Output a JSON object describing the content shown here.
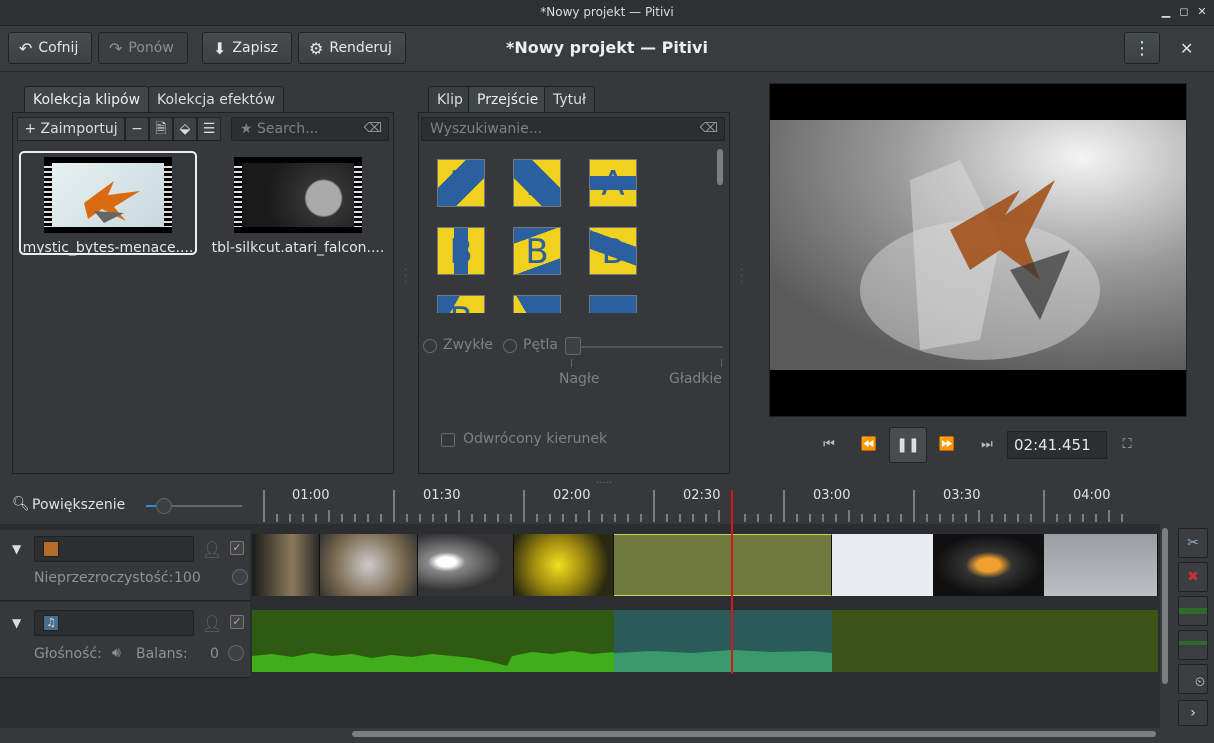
{
  "window": {
    "title": "*Nowy projekt — Pitivi",
    "minimize_icon": "minimize-icon",
    "maximize_icon": "maximize-icon",
    "close_icon": "close-icon"
  },
  "header": {
    "undo_label": "Cofnij",
    "redo_label": "Ponów",
    "save_label": "Zapisz",
    "render_label": "Renderuj",
    "title": "*Nowy projekt — Pitivi"
  },
  "library": {
    "tabs": [
      "Kolekcja klipów",
      "Kolekcja efektów"
    ],
    "import_label": "Zaimportuj",
    "search_placeholder": "Search...",
    "clips": [
      {
        "name": "mystic_bytes-menace...."
      },
      {
        "name": "tbl-silkcut.atari_falcon...."
      }
    ]
  },
  "transitions": {
    "tabs": [
      "Klip",
      "Przejście",
      "Tytuł"
    ],
    "search_placeholder": "Wyszukiwanie...",
    "thumbs": [
      "B",
      "B",
      "A",
      "B",
      "B",
      "B",
      "B",
      "B",
      "B"
    ],
    "mode_normal": "Zwykłe",
    "mode_loop": "Pętla",
    "border_left": "Nagłe",
    "border_right": "Gładkie",
    "invert_label": "Odwrócony kierunek"
  },
  "viewer": {
    "timecode": "02:41.451"
  },
  "timeline": {
    "zoom_label": "Powiększenie",
    "ruler": [
      "01:00",
      "01:30",
      "02:00",
      "02:30",
      "03:00",
      "03:30",
      "04:00"
    ],
    "video_layer": {
      "opacity_label": "Nieprzezroczystość:",
      "opacity_value": "100"
    },
    "audio_layer": {
      "volume_label": "Głośność:",
      "balance_label": "Balans:",
      "balance_value": "0"
    }
  },
  "colors": {
    "accent": "#2b5f9e",
    "playhead": "#d81818",
    "audio_wave": "#3fae1a",
    "selected_clip": "#6f7a3c"
  }
}
